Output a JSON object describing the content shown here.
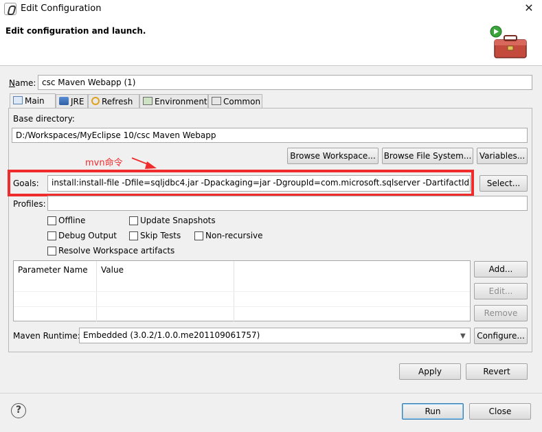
{
  "window": {
    "title": "Edit Configuration",
    "close_glyph": "✕"
  },
  "header": {
    "title": "Edit configuration and launch."
  },
  "name": {
    "label": "Name:",
    "value": "csc Maven Webapp (1)"
  },
  "tabs": [
    {
      "label": "Main"
    },
    {
      "label": "JRE"
    },
    {
      "label": "Refresh"
    },
    {
      "label": "Environment"
    },
    {
      "label": "Common"
    }
  ],
  "base_dir": {
    "label": "Base directory:",
    "value": "D:/Workspaces/MyEclipse 10/csc Maven Webapp",
    "browse_workspace": "Browse Workspace...",
    "browse_fs": "Browse File System...",
    "variables": "Variables..."
  },
  "annotation": "mvn命令",
  "goals": {
    "label": "Goals:",
    "value": "install:install-file -Dfile=sqljdbc4.jar -Dpackaging=jar -DgroupId=com.microsoft.sqlserver -DartifactId=sc",
    "select": "Select..."
  },
  "profiles": {
    "label": "Profiles:",
    "value": ""
  },
  "options": {
    "offline": "Offline",
    "update_snapshots": "Update Snapshots",
    "debug_output": "Debug Output",
    "skip_tests": "Skip Tests",
    "non_recursive": "Non-recursive",
    "resolve_workspace": "Resolve Workspace artifacts"
  },
  "params": {
    "col_name": "Parameter Name",
    "col_value": "Value",
    "add": "Add...",
    "edit": "Edit...",
    "remove": "Remove"
  },
  "runtime": {
    "label": "Maven Runtime:",
    "value": "Embedded (3.0.2/1.0.0.me201109061757)",
    "configure": "Configure..."
  },
  "actions": {
    "apply": "Apply",
    "revert": "Revert",
    "run": "Run",
    "close": "Close"
  },
  "help_glyph": "?"
}
